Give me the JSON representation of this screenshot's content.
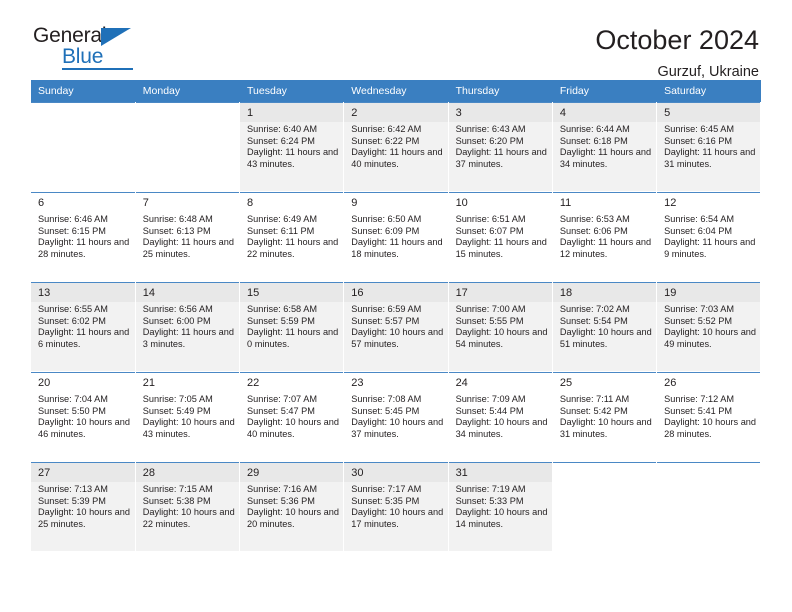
{
  "brand": {
    "name_top": "General",
    "name_bottom": "Blue"
  },
  "header": {
    "title": "October 2024",
    "subtitle": "Gurzuf, Ukraine"
  },
  "colors": {
    "header_blue": "#3a7fc1",
    "brand_blue": "#1f70b8",
    "row_shade": "#f2f2f2",
    "daynum_shade": "#e8e8e8",
    "text": "#231f20"
  },
  "day_headers": [
    "Sunday",
    "Monday",
    "Tuesday",
    "Wednesday",
    "Thursday",
    "Friday",
    "Saturday"
  ],
  "labels": {
    "sunrise": "Sunrise:",
    "sunset": "Sunset:",
    "daylight": "Daylight:"
  },
  "weeks": [
    [
      {
        "day": "",
        "sunrise": "",
        "sunset": "",
        "daylight": "",
        "empty": true
      },
      {
        "day": "",
        "sunrise": "",
        "sunset": "",
        "daylight": "",
        "empty": true
      },
      {
        "day": "1",
        "sunrise": "Sunrise: 6:40 AM",
        "sunset": "Sunset: 6:24 PM",
        "daylight": "Daylight: 11 hours and 43 minutes."
      },
      {
        "day": "2",
        "sunrise": "Sunrise: 6:42 AM",
        "sunset": "Sunset: 6:22 PM",
        "daylight": "Daylight: 11 hours and 40 minutes."
      },
      {
        "day": "3",
        "sunrise": "Sunrise: 6:43 AM",
        "sunset": "Sunset: 6:20 PM",
        "daylight": "Daylight: 11 hours and 37 minutes."
      },
      {
        "day": "4",
        "sunrise": "Sunrise: 6:44 AM",
        "sunset": "Sunset: 6:18 PM",
        "daylight": "Daylight: 11 hours and 34 minutes."
      },
      {
        "day": "5",
        "sunrise": "Sunrise: 6:45 AM",
        "sunset": "Sunset: 6:16 PM",
        "daylight": "Daylight: 11 hours and 31 minutes."
      }
    ],
    [
      {
        "day": "6",
        "sunrise": "Sunrise: 6:46 AM",
        "sunset": "Sunset: 6:15 PM",
        "daylight": "Daylight: 11 hours and 28 minutes."
      },
      {
        "day": "7",
        "sunrise": "Sunrise: 6:48 AM",
        "sunset": "Sunset: 6:13 PM",
        "daylight": "Daylight: 11 hours and 25 minutes."
      },
      {
        "day": "8",
        "sunrise": "Sunrise: 6:49 AM",
        "sunset": "Sunset: 6:11 PM",
        "daylight": "Daylight: 11 hours and 22 minutes."
      },
      {
        "day": "9",
        "sunrise": "Sunrise: 6:50 AM",
        "sunset": "Sunset: 6:09 PM",
        "daylight": "Daylight: 11 hours and 18 minutes."
      },
      {
        "day": "10",
        "sunrise": "Sunrise: 6:51 AM",
        "sunset": "Sunset: 6:07 PM",
        "daylight": "Daylight: 11 hours and 15 minutes."
      },
      {
        "day": "11",
        "sunrise": "Sunrise: 6:53 AM",
        "sunset": "Sunset: 6:06 PM",
        "daylight": "Daylight: 11 hours and 12 minutes."
      },
      {
        "day": "12",
        "sunrise": "Sunrise: 6:54 AM",
        "sunset": "Sunset: 6:04 PM",
        "daylight": "Daylight: 11 hours and 9 minutes."
      }
    ],
    [
      {
        "day": "13",
        "sunrise": "Sunrise: 6:55 AM",
        "sunset": "Sunset: 6:02 PM",
        "daylight": "Daylight: 11 hours and 6 minutes."
      },
      {
        "day": "14",
        "sunrise": "Sunrise: 6:56 AM",
        "sunset": "Sunset: 6:00 PM",
        "daylight": "Daylight: 11 hours and 3 minutes."
      },
      {
        "day": "15",
        "sunrise": "Sunrise: 6:58 AM",
        "sunset": "Sunset: 5:59 PM",
        "daylight": "Daylight: 11 hours and 0 minutes."
      },
      {
        "day": "16",
        "sunrise": "Sunrise: 6:59 AM",
        "sunset": "Sunset: 5:57 PM",
        "daylight": "Daylight: 10 hours and 57 minutes."
      },
      {
        "day": "17",
        "sunrise": "Sunrise: 7:00 AM",
        "sunset": "Sunset: 5:55 PM",
        "daylight": "Daylight: 10 hours and 54 minutes."
      },
      {
        "day": "18",
        "sunrise": "Sunrise: 7:02 AM",
        "sunset": "Sunset: 5:54 PM",
        "daylight": "Daylight: 10 hours and 51 minutes."
      },
      {
        "day": "19",
        "sunrise": "Sunrise: 7:03 AM",
        "sunset": "Sunset: 5:52 PM",
        "daylight": "Daylight: 10 hours and 49 minutes."
      }
    ],
    [
      {
        "day": "20",
        "sunrise": "Sunrise: 7:04 AM",
        "sunset": "Sunset: 5:50 PM",
        "daylight": "Daylight: 10 hours and 46 minutes."
      },
      {
        "day": "21",
        "sunrise": "Sunrise: 7:05 AM",
        "sunset": "Sunset: 5:49 PM",
        "daylight": "Daylight: 10 hours and 43 minutes."
      },
      {
        "day": "22",
        "sunrise": "Sunrise: 7:07 AM",
        "sunset": "Sunset: 5:47 PM",
        "daylight": "Daylight: 10 hours and 40 minutes."
      },
      {
        "day": "23",
        "sunrise": "Sunrise: 7:08 AM",
        "sunset": "Sunset: 5:45 PM",
        "daylight": "Daylight: 10 hours and 37 minutes."
      },
      {
        "day": "24",
        "sunrise": "Sunrise: 7:09 AM",
        "sunset": "Sunset: 5:44 PM",
        "daylight": "Daylight: 10 hours and 34 minutes."
      },
      {
        "day": "25",
        "sunrise": "Sunrise: 7:11 AM",
        "sunset": "Sunset: 5:42 PM",
        "daylight": "Daylight: 10 hours and 31 minutes."
      },
      {
        "day": "26",
        "sunrise": "Sunrise: 7:12 AM",
        "sunset": "Sunset: 5:41 PM",
        "daylight": "Daylight: 10 hours and 28 minutes."
      }
    ],
    [
      {
        "day": "27",
        "sunrise": "Sunrise: 7:13 AM",
        "sunset": "Sunset: 5:39 PM",
        "daylight": "Daylight: 10 hours and 25 minutes."
      },
      {
        "day": "28",
        "sunrise": "Sunrise: 7:15 AM",
        "sunset": "Sunset: 5:38 PM",
        "daylight": "Daylight: 10 hours and 22 minutes."
      },
      {
        "day": "29",
        "sunrise": "Sunrise: 7:16 AM",
        "sunset": "Sunset: 5:36 PM",
        "daylight": "Daylight: 10 hours and 20 minutes."
      },
      {
        "day": "30",
        "sunrise": "Sunrise: 7:17 AM",
        "sunset": "Sunset: 5:35 PM",
        "daylight": "Daylight: 10 hours and 17 minutes."
      },
      {
        "day": "31",
        "sunrise": "Sunrise: 7:19 AM",
        "sunset": "Sunset: 5:33 PM",
        "daylight": "Daylight: 10 hours and 14 minutes."
      },
      {
        "day": "",
        "sunrise": "",
        "sunset": "",
        "daylight": "",
        "empty": true
      },
      {
        "day": "",
        "sunrise": "",
        "sunset": "",
        "daylight": "",
        "empty": true
      }
    ]
  ]
}
